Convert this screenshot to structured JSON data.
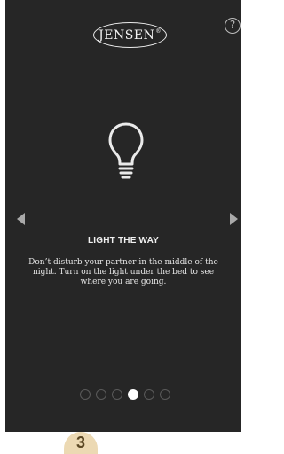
{
  "brand": {
    "logo_text": "JENSEN",
    "logo_mark": "®"
  },
  "help": {
    "label": "?"
  },
  "slide": {
    "icon": "lightbulb-icon",
    "title": "LIGHT THE WAY",
    "body": "Don’t disturb your partner in the middle of the night. Turn on the light under the bed to see where you are going."
  },
  "pager": {
    "total": 6,
    "current": 4
  },
  "step": {
    "number": "3"
  },
  "colors": {
    "screen_bg": "#262626",
    "badge_bg": "#ecd9b3",
    "badge_text": "#5a4723"
  }
}
